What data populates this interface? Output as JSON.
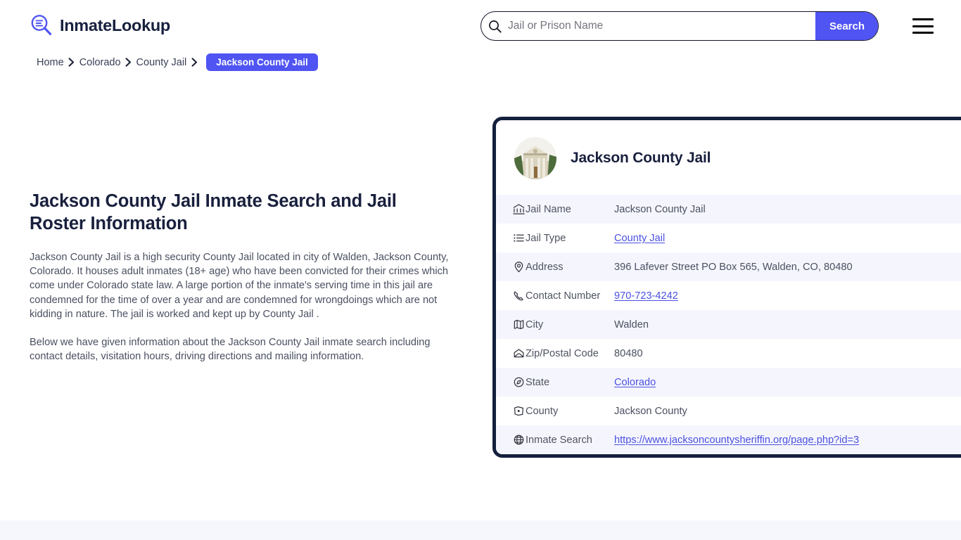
{
  "header": {
    "brand_name": "InmateLookup",
    "brand_icon": "magnifier-list-icon",
    "search": {
      "placeholder": "Jail or Prison Name",
      "value": "",
      "icon": "search-icon",
      "button_label": "Search"
    },
    "menu_icon": "hamburger-menu-icon"
  },
  "breadcrumb": {
    "items": [
      {
        "label": "Home",
        "current": false
      },
      {
        "label": "Colorado",
        "current": false
      },
      {
        "label": "County Jail",
        "current": false
      }
    ],
    "current": "Jackson County Jail",
    "separator": "❯"
  },
  "main": {
    "title": "Jackson County Jail Inmate Search and Jail Roster Information",
    "paragraphs": [
      "Jackson County Jail is a high security County Jail located in city of Walden, Jackson County, Colorado. It houses adult inmates (18+ age) who have been convicted for their crimes which come under Colorado state law. A large portion of the inmate's serving time in this jail are condemned for the time of over a year and are condemned for wrongdoings which are not kidding in nature. The jail is worked and kept up by County Jail .",
      "Below we have given information about the Jackson County Jail inmate search including contact details, visitation hours, driving directions and mailing information."
    ]
  },
  "card": {
    "avatar_icon": "courthouse-photo",
    "title": "Jackson County Jail",
    "rows": [
      {
        "icon": "bank-icon",
        "label": "Jail Name",
        "value": "Jackson County Jail",
        "link": false
      },
      {
        "icon": "list-icon",
        "label": "Jail Type",
        "value": "County Jail",
        "link": true
      },
      {
        "icon": "map-pin-icon",
        "label": "Address",
        "value": "396 Lafever Street PO Box 565, Walden, CO, 80480",
        "link": false
      },
      {
        "icon": "phone-icon",
        "label": "Contact Number",
        "value": "970-723-4242",
        "link": true
      },
      {
        "icon": "map-icon",
        "label": "City",
        "value": "Walden",
        "link": false
      },
      {
        "icon": "envelope-icon",
        "label": "Zip/Postal Code",
        "value": "80480",
        "link": false
      },
      {
        "icon": "compass-icon",
        "label": "State",
        "value": "Colorado",
        "link": true
      },
      {
        "icon": "county-map-icon",
        "label": "County",
        "value": "Jackson County",
        "link": false
      },
      {
        "icon": "globe-icon",
        "label": "Inmate Search",
        "value": "https://www.jacksoncountysheriffin.org/page.php?id=3",
        "link": true
      }
    ]
  },
  "colors": {
    "accent": "#4f54f2",
    "navy": "#14203c",
    "link": "#4a50e0",
    "row_alt": "#f5f6fd",
    "band": "#f6f7fd"
  }
}
